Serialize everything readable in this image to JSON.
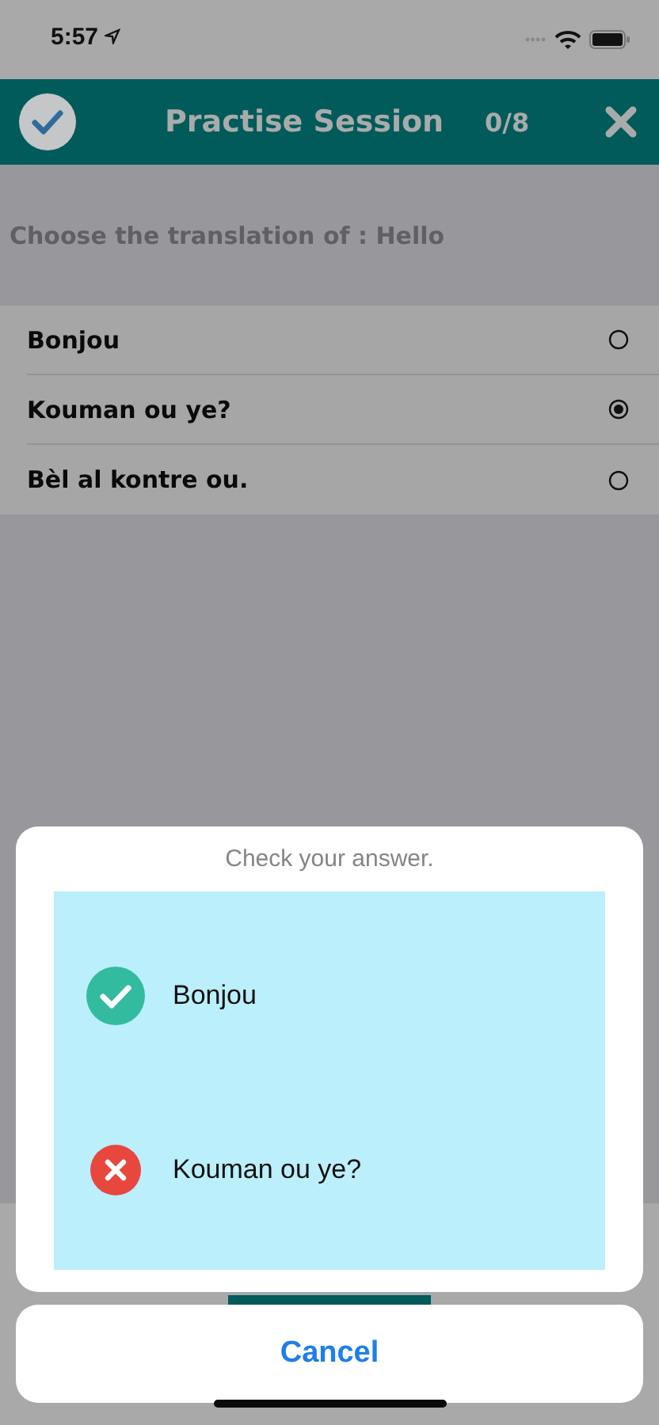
{
  "status_bar": {
    "time": "5:57"
  },
  "header": {
    "title": "Practise Session",
    "progress": "0/8"
  },
  "question": "Choose the translation of : Hello",
  "options": [
    {
      "label": "Bonjou",
      "selected": false
    },
    {
      "label": "Kouman ou ye?",
      "selected": true
    },
    {
      "label": "Bèl al kontre ou.",
      "selected": false
    }
  ],
  "sheet": {
    "title": "Check your answer.",
    "results": [
      {
        "answer": "Bonjou",
        "correct": true
      },
      {
        "answer": "Kouman ou ye?",
        "correct": false
      }
    ],
    "cancel": "Cancel"
  }
}
